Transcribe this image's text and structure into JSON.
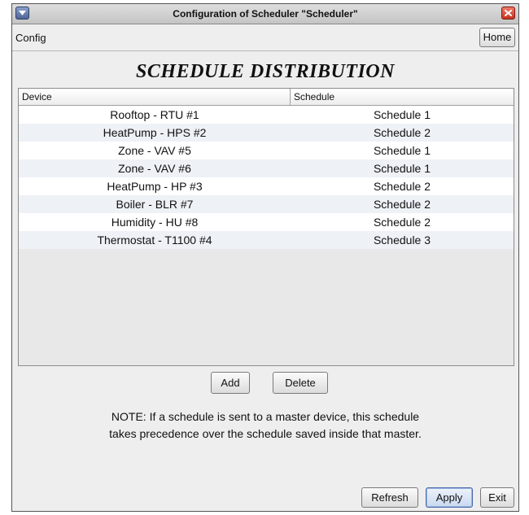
{
  "window": {
    "title": "Configuration of Scheduler \"Scheduler\""
  },
  "menubar": {
    "config_label": "Config",
    "home_label": "Home"
  },
  "heading": "SCHEDULE DISTRIBUTION",
  "table": {
    "columns": [
      "Device",
      "Schedule"
    ],
    "rows": [
      {
        "device": "Rooftop - RTU #1",
        "schedule": "Schedule 1"
      },
      {
        "device": "HeatPump - HPS #2",
        "schedule": "Schedule 2"
      },
      {
        "device": "Zone - VAV #5",
        "schedule": "Schedule 1"
      },
      {
        "device": "Zone - VAV #6",
        "schedule": "Schedule 1"
      },
      {
        "device": "HeatPump - HP #3",
        "schedule": "Schedule 2"
      },
      {
        "device": "Boiler - BLR #7",
        "schedule": "Schedule 2"
      },
      {
        "device": "Humidity - HU #8",
        "schedule": "Schedule 2"
      },
      {
        "device": "Thermostat - T1100 #4",
        "schedule": "Schedule 3"
      }
    ]
  },
  "actions": {
    "add_label": "Add",
    "delete_label": "Delete"
  },
  "note": {
    "line1": "NOTE: If a schedule is sent to a master device, this schedule",
    "line2": "takes precedence over the schedule saved inside that master."
  },
  "footer": {
    "refresh_label": "Refresh",
    "apply_label": "Apply",
    "exit_label": "Exit"
  },
  "icons": {
    "window_menu": "window-menu-icon",
    "close": "close-icon"
  },
  "colors": {
    "close_button": "#d9442e",
    "apply_border": "#4a6aa8",
    "row_alt": "#eef1f6"
  }
}
